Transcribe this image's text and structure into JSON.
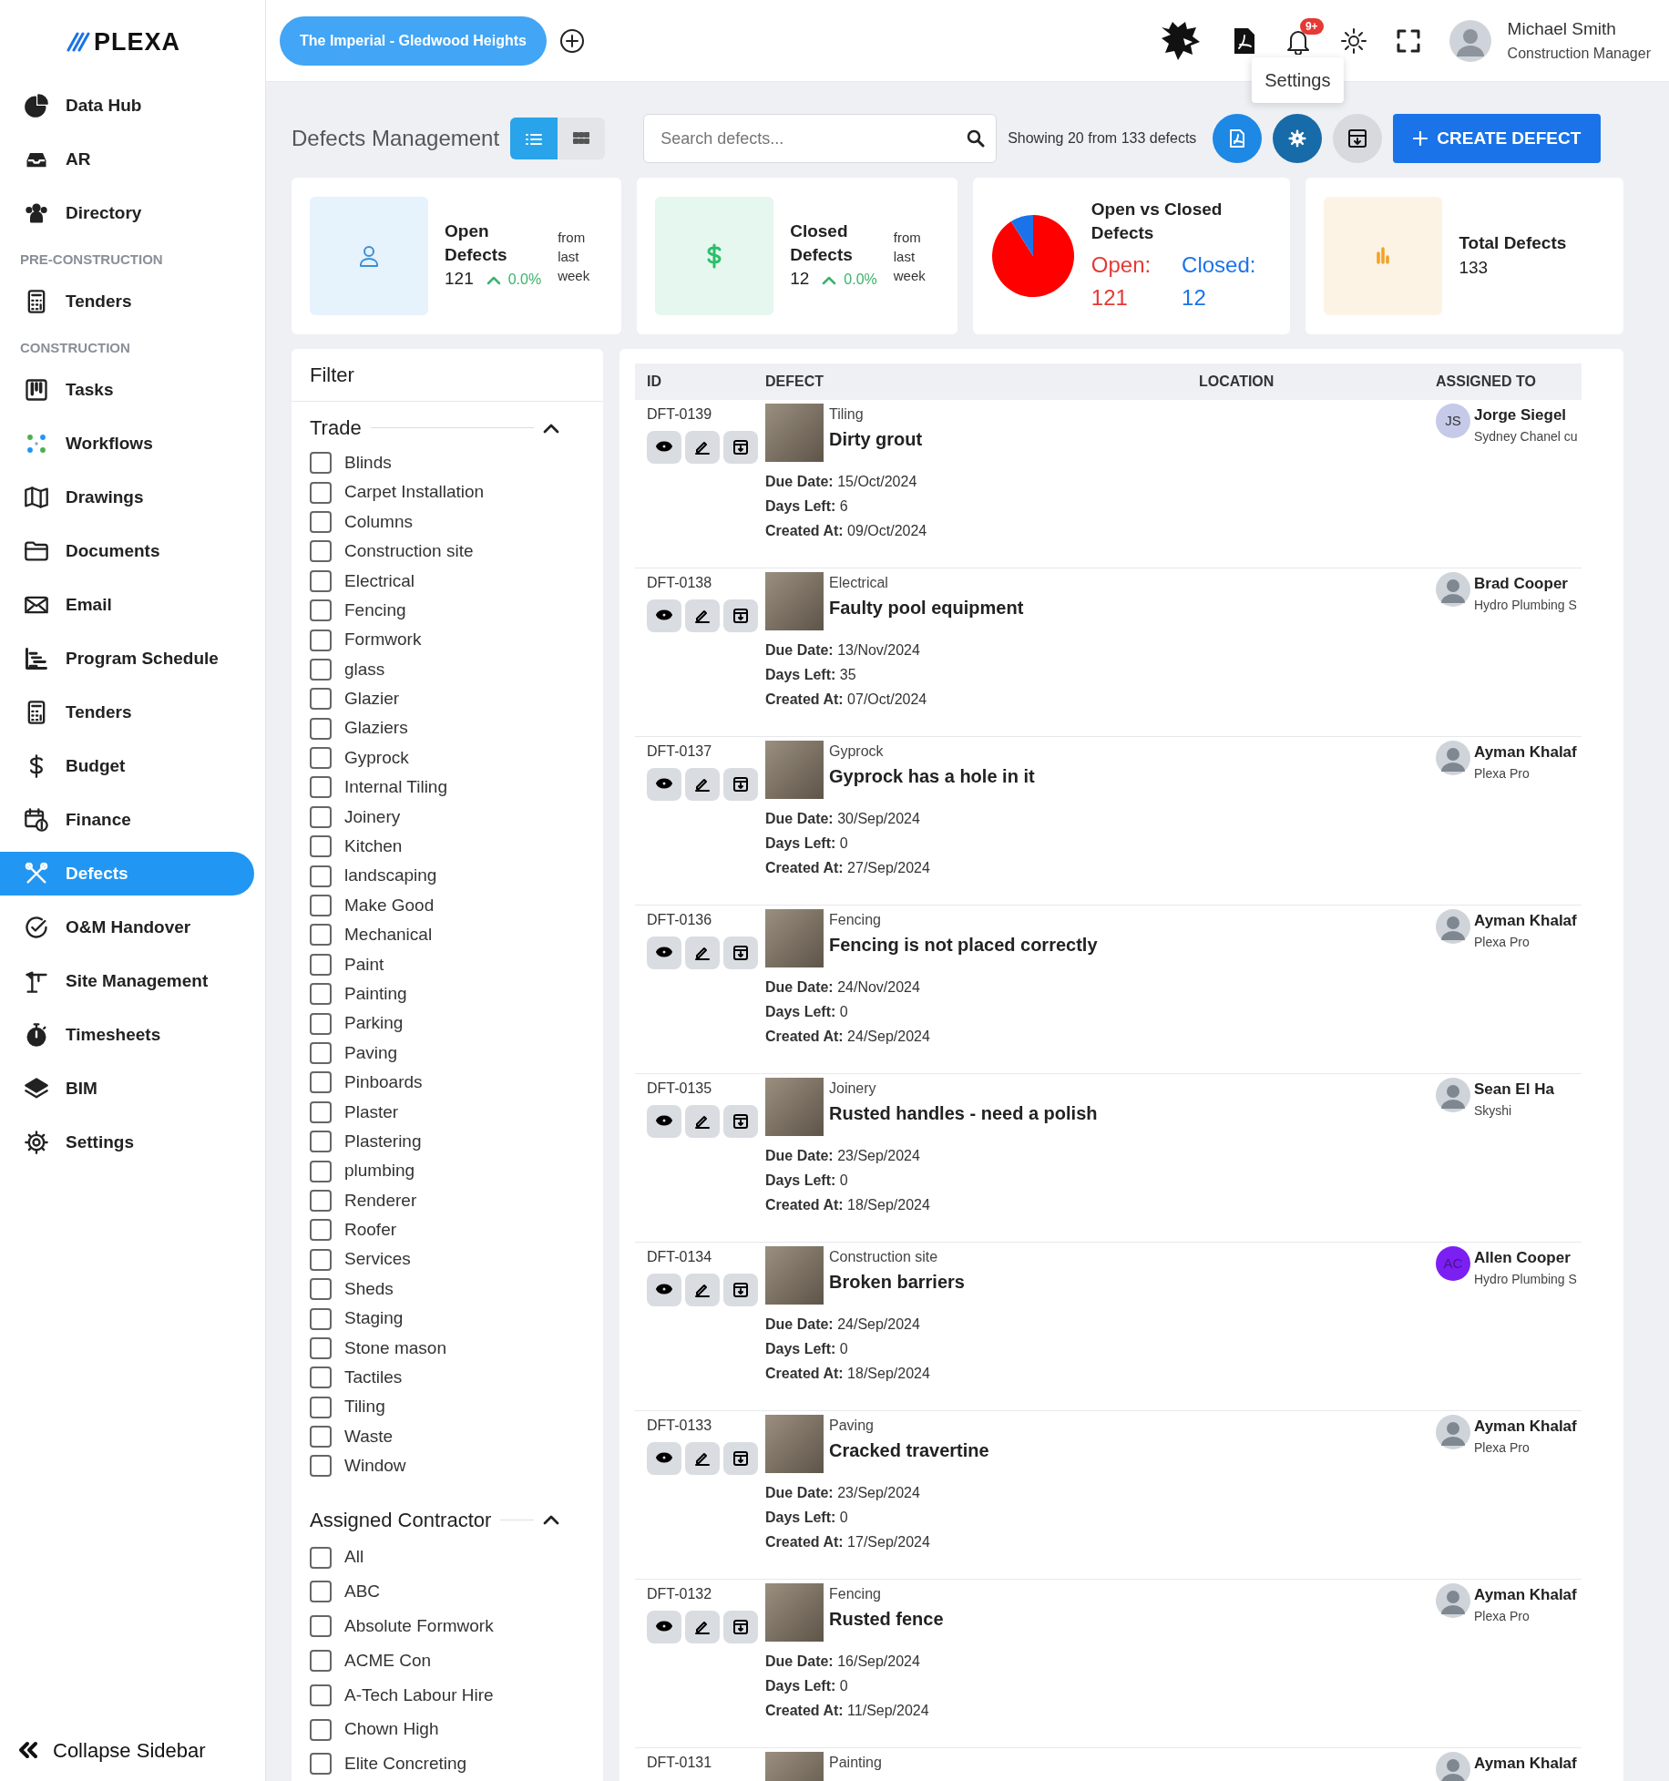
{
  "sidebar": {
    "logo": "PLEXA",
    "items": [
      {
        "kind": "item",
        "label": "Data Hub",
        "selected": false
      },
      {
        "kind": "item",
        "label": "AR",
        "selected": false
      },
      {
        "kind": "item",
        "label": "Directory",
        "selected": false
      },
      {
        "kind": "section",
        "label": "PRE-CONSTRUCTION"
      },
      {
        "kind": "item",
        "label": "Tenders",
        "selected": false
      },
      {
        "kind": "section",
        "label": "CONSTRUCTION"
      },
      {
        "kind": "item",
        "label": "Tasks",
        "selected": false
      },
      {
        "kind": "item",
        "label": "Workflows",
        "selected": false
      },
      {
        "kind": "item",
        "label": "Drawings",
        "selected": false
      },
      {
        "kind": "item",
        "label": "Documents",
        "selected": false
      },
      {
        "kind": "item",
        "label": "Email",
        "selected": false
      },
      {
        "kind": "item",
        "label": "Program Schedule",
        "selected": false
      },
      {
        "kind": "item",
        "label": "Tenders",
        "selected": false
      },
      {
        "kind": "item",
        "label": "Budget",
        "selected": false
      },
      {
        "kind": "item",
        "label": "Finance",
        "selected": false
      },
      {
        "kind": "item",
        "label": "Defects",
        "selected": true
      },
      {
        "kind": "item",
        "label": "O&M Handover",
        "selected": false
      },
      {
        "kind": "item",
        "label": "Site Management",
        "selected": false
      },
      {
        "kind": "item",
        "label": "Timesheets",
        "selected": false
      },
      {
        "kind": "item",
        "label": "BIM",
        "selected": false
      },
      {
        "kind": "item",
        "label": "Settings",
        "selected": false
      }
    ],
    "collapse": "Collapse Sidebar"
  },
  "topbar": {
    "project": "The Imperial - Gledwood Heights",
    "notifications": "9+",
    "user": {
      "name": "Michael Smith",
      "role": "Construction Manager"
    }
  },
  "header": {
    "title": "Defects Management",
    "views": [
      {
        "selected": true
      },
      {
        "selected": false
      }
    ],
    "search": {
      "placeholder": "Search defects..."
    },
    "showing": "Showing 20 from 133 defects",
    "tooltip": "Settings",
    "create_button": "CREATE DEFECT"
  },
  "stats": [
    {
      "kind": "trend",
      "label": "Open Defects",
      "value": "121",
      "change": "0.0%",
      "note": "from last week"
    },
    {
      "kind": "trend",
      "label": "Closed Defects",
      "value": "12",
      "change": "0.0%",
      "note": "from last week"
    },
    {
      "kind": "pie",
      "label": "Open vs Closed Defects",
      "open_label": "Open:",
      "open_value": "121",
      "closed_label": "Closed:",
      "closed_value": "12"
    },
    {
      "kind": "total",
      "label": "Total Defects",
      "value": "133"
    }
  ],
  "filter": {
    "title": "Filter",
    "groups": [
      {
        "title": "Trade",
        "expanded": true,
        "options": [
          {
            "label": "Blinds",
            "checked": false
          },
          {
            "label": "Carpet Installation",
            "checked": false
          },
          {
            "label": "Columns",
            "checked": false
          },
          {
            "label": "Construction site",
            "checked": false
          },
          {
            "label": "Electrical",
            "checked": false
          },
          {
            "label": "Fencing",
            "checked": false
          },
          {
            "label": "Formwork",
            "checked": false
          },
          {
            "label": "glass",
            "checked": false
          },
          {
            "label": "Glazier",
            "checked": false
          },
          {
            "label": "Glaziers",
            "checked": false
          },
          {
            "label": "Gyprock",
            "checked": false
          },
          {
            "label": "Internal Tiling",
            "checked": false
          },
          {
            "label": "Joinery",
            "checked": false
          },
          {
            "label": "Kitchen",
            "checked": false
          },
          {
            "label": "landscaping",
            "checked": false
          },
          {
            "label": "Make Good",
            "checked": false
          },
          {
            "label": "Mechanical",
            "checked": false
          },
          {
            "label": "Paint",
            "checked": false
          },
          {
            "label": "Painting",
            "checked": false
          },
          {
            "label": "Parking",
            "checked": false
          },
          {
            "label": "Paving",
            "checked": false
          },
          {
            "label": "Pinboards",
            "checked": false
          },
          {
            "label": "Plaster",
            "checked": false
          },
          {
            "label": "Plastering",
            "checked": false
          },
          {
            "label": "plumbing",
            "checked": false
          },
          {
            "label": "Renderer",
            "checked": false
          },
          {
            "label": "Roofer",
            "checked": false
          },
          {
            "label": "Services",
            "checked": false
          },
          {
            "label": "Sheds",
            "checked": false
          },
          {
            "label": "Staging",
            "checked": false
          },
          {
            "label": "Stone mason",
            "checked": false
          },
          {
            "label": "Tactiles",
            "checked": false
          },
          {
            "label": "Tiling",
            "checked": false
          },
          {
            "label": "Waste",
            "checked": false
          },
          {
            "label": "Window",
            "checked": false
          }
        ]
      },
      {
        "title": "Assigned Contractor",
        "expanded": true,
        "options": [
          {
            "label": "All",
            "checked": false
          },
          {
            "label": "ABC",
            "checked": false
          },
          {
            "label": "Absolute Formwork",
            "checked": false
          },
          {
            "label": "ACME Con",
            "checked": false
          },
          {
            "label": "A-Tech Labour Hire",
            "checked": false
          },
          {
            "label": "Chown High",
            "checked": false
          },
          {
            "label": "Elite Concreting",
            "checked": false
          }
        ]
      }
    ]
  },
  "table": {
    "columns": [
      "ID",
      "DEFECT",
      "LOCATION",
      "ASSIGNED TO"
    ],
    "rows": [
      {
        "id": "DFT-0139",
        "trade": "Tiling",
        "title": "Dirty grout",
        "details": [
          "**Due Date:** 15/Oct/2024",
          "**Days Left:** 6",
          "**Created At:** 09/Oct/2024"
        ],
        "assignee": {
          "kind": "initials",
          "initials": "JS",
          "color": "#c5cae9",
          "name": "Jorge Siegel",
          "company": "Sydney Chanel cu"
        }
      },
      {
        "id": "DFT-0138",
        "trade": "Electrical",
        "title": "Faulty pool equipment",
        "details": [
          "**Due Date:** 13/Nov/2024",
          "**Days Left:** 35",
          "**Created At:** 07/Oct/2024"
        ],
        "assignee": {
          "kind": "photo",
          "name": "Brad Cooper",
          "company": "Hydro Plumbing S"
        }
      },
      {
        "id": "DFT-0137",
        "trade": "Gyprock",
        "title": "Gyprock has a hole in it",
        "details": [
          "**Due Date:** 30/Sep/2024",
          "**Days Left:** 0",
          "**Created At:** 27/Sep/2024"
        ],
        "assignee": {
          "kind": "photo",
          "name": "Ayman Khalaf",
          "company": "Plexa Pro"
        }
      },
      {
        "id": "DFT-0136",
        "trade": "Fencing",
        "title": "Fencing is not placed correctly",
        "details": [
          "**Due Date:** 24/Nov/2024",
          "**Days Left:** 0",
          "**Created At:** 24/Sep/2024"
        ],
        "assignee": {
          "kind": "photo",
          "name": "Ayman Khalaf",
          "company": "Plexa Pro"
        }
      },
      {
        "id": "DFT-0135",
        "trade": "Joinery",
        "title": "Rusted handles - need a polish",
        "details": [
          "**Due Date:** 23/Sep/2024",
          "**Days Left:** 0",
          "**Created At:** 18/Sep/2024"
        ],
        "assignee": {
          "kind": "photo",
          "name": "Sean El Ha",
          "company": "Skyshi"
        }
      },
      {
        "id": "DFT-0134",
        "trade": "Construction site",
        "title": "Broken barriers",
        "details": [
          "**Due Date:** 24/Sep/2024",
          "**Days Left:** 0",
          "**Created At:** 18/Sep/2024"
        ],
        "assignee": {
          "kind": "initials",
          "initials": "AC",
          "color": "#7b1ff2",
          "name": "Allen Cooper",
          "company": "Hydro Plumbing S"
        }
      },
      {
        "id": "DFT-0133",
        "trade": "Paving",
        "title": "Cracked travertine",
        "details": [
          "**Due Date:** 23/Sep/2024",
          "**Days Left:** 0",
          "**Created At:** 17/Sep/2024"
        ],
        "assignee": {
          "kind": "photo",
          "name": "Ayman Khalaf",
          "company": "Plexa Pro"
        }
      },
      {
        "id": "DFT-0132",
        "trade": "Fencing",
        "title": "Rusted fence",
        "details": [
          "**Due Date:** 16/Sep/2024",
          "**Days Left:** 0",
          "**Created At:** 11/Sep/2024"
        ],
        "assignee": {
          "kind": "photo",
          "name": "Ayman Khalaf",
          "company": "Plexa Pro"
        }
      },
      {
        "id": "DFT-0131",
        "trade": "Painting",
        "assignee": {
          "kind": "photo",
          "name": "Ayman Khalaf"
        }
      }
    ]
  }
}
